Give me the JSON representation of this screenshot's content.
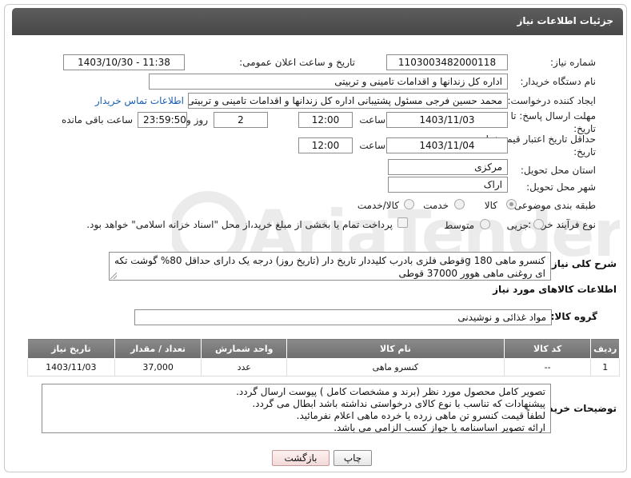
{
  "header": {
    "title": "جزئیات اطلاعات نیاز"
  },
  "fields": {
    "need_number_label": "شماره نیاز:",
    "need_number": "1103003482000118",
    "announce_label": "تاریخ و ساعت اعلان عمومی:",
    "announce_value": "1403/10/30 - 11:38",
    "buyer_org_label": "نام دستگاه خریدار:",
    "buyer_org": "اداره کل زندانها و اقدامات تامینی و تربیتی",
    "requester_label": "ایجاد کننده درخواست:",
    "requester": "محمد حسین فرجی مسئول پشتیبانی اداره کل زندانها و اقدامات تامینی و تربیتی",
    "buyer_contact_link": "اطلاعات تماس خریدار",
    "deadline_label_line1": "مهلت ارسال پاسخ: تا",
    "deadline_label_line2": "تاریخ:",
    "deadline_date": "1403/11/03",
    "time_word": "ساعت",
    "deadline_time": "12:00",
    "days_value": "2",
    "days_and_word": "روز و",
    "remaining_time": "23:59:50",
    "remaining_word": "ساعت باقی مانده",
    "validity_label_line1": "حداقل تاریخ اعتبار قیمت: تا",
    "validity_label_line2": "تاریخ:",
    "validity_date": "1403/11/04",
    "validity_time": "12:00",
    "province_label": "استان محل تحویل:",
    "province": "مرکزی",
    "city_label": "شهر محل تحویل:",
    "city": "اراک",
    "category_label": "طبقه بندی موضوعی:",
    "category_options": [
      "کالا",
      "خدمت",
      "کالا/خدمت"
    ],
    "process_label": "نوع فرآیند خرید :",
    "process_options": [
      "جزیی",
      "متوسط"
    ],
    "payment_note": "پرداخت تمام یا بخشی از مبلغ خرید،از محل \"اسناد خزانه اسلامی\" خواهد بود."
  },
  "description": {
    "label": "شرح کلی نیاز:",
    "text": "کنسرو ماهی 180 gقوطی فلزی بادرب کلیددار تاریخ دار (تاریخ روز) درجه یک دارای حداقل 80% گوشت تکه ای روغنی ماهی هوور 37000 قوطی"
  },
  "goods": {
    "section_title": "اطلاعات کالاهای مورد نیاز",
    "group_label": "گروه کالا:",
    "group_value": "مواد غذائی و نوشیدنی",
    "columns": [
      "ردیف",
      "کد کالا",
      "نام کالا",
      "واحد شمارش",
      "تعداد / مقدار",
      "تاریخ نیاز"
    ],
    "rows": [
      [
        "1",
        "--",
        "کنسرو ماهی",
        "عدد",
        "37,000",
        "1403/11/03"
      ]
    ]
  },
  "buyer_notes": {
    "label": "توضیحات خریدار:",
    "lines": [
      "تصویر کامل محصول مورد نظر (برند و مشخصات کامل ) پیوست ارسال گردد.",
      "پیشنهادات که تناسب با نوع کالای درخواستی نداشته باشد ابطال می گردد.",
      "لطفاً قیمت کنسرو تن ماهی زرده یا خرده ماهی اعلام نفرمائید.",
      "ارائه تصویر اساسنامه یا جواز کسب الزامی می باشد."
    ]
  },
  "buttons": {
    "print": "چاپ",
    "back": "بازگشت"
  },
  "colors": {
    "header_bg": "#4f4f4f",
    "link": "#1a5fb4",
    "table_header": "#7a7a7a"
  }
}
